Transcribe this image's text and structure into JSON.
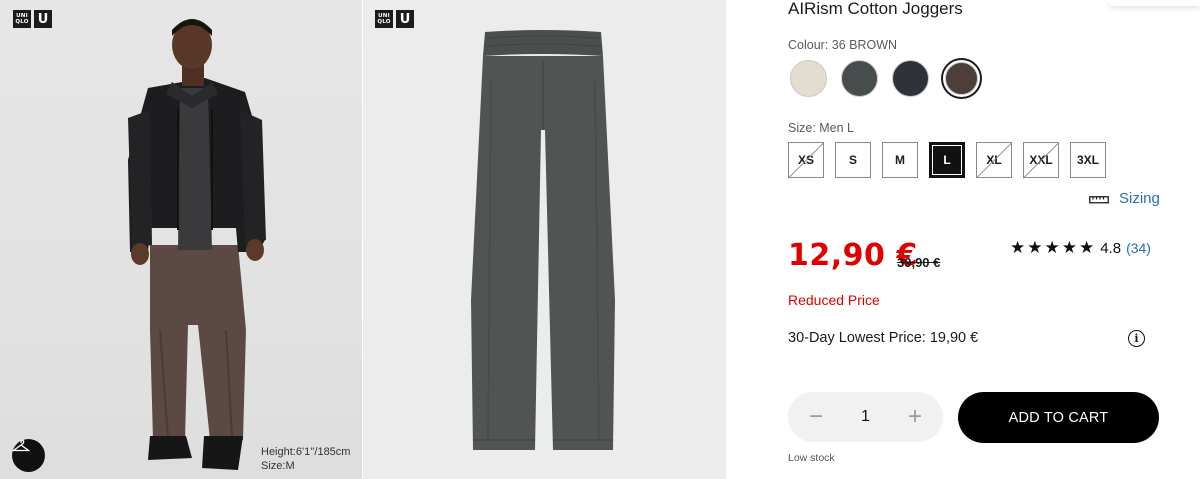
{
  "gallery": {
    "logo_top": "UNI",
    "logo_bottom": "QLO",
    "logo_u": "U",
    "model_height": "Height:6'1''/185cm",
    "model_size": "Size:M"
  },
  "product": {
    "title": "AIRism Cotton Joggers",
    "colour_label": "Colour: 36 BROWN",
    "colours": [
      {
        "name": "beige",
        "hex": "#e3ddd0",
        "selected": false
      },
      {
        "name": "dark-grey",
        "hex": "#474d4c",
        "selected": false
      },
      {
        "name": "navy",
        "hex": "#2f3239",
        "selected": false
      },
      {
        "name": "brown",
        "hex": "#4e3e3a",
        "selected": true
      }
    ],
    "size_label": "Size: Men L",
    "sizes": [
      {
        "label": "XS",
        "available": false,
        "selected": false
      },
      {
        "label": "S",
        "available": true,
        "selected": false
      },
      {
        "label": "M",
        "available": true,
        "selected": false
      },
      {
        "label": "L",
        "available": true,
        "selected": true
      },
      {
        "label": "XL",
        "available": false,
        "selected": false
      },
      {
        "label": "XXL",
        "available": false,
        "selected": false
      },
      {
        "label": "3XL",
        "available": true,
        "selected": false
      }
    ],
    "sizing_link": "Sizing",
    "price": "12,90 €",
    "old_price": "39,90 €",
    "rating_stars": "★★★★★",
    "rating_value": "4.8",
    "rating_count": "(34)",
    "reduced_label": "Reduced Price",
    "lowest_price": "30-Day Lowest Price: 19,90 €",
    "info_icon": "i",
    "quantity": "1",
    "qty_minus": "−",
    "qty_plus": "+",
    "add_to_cart": "ADD TO CART",
    "stock_status": "Low stock"
  },
  "colors": {
    "price_red": "#e00000",
    "link_blue": "#2a6db5",
    "button_black": "#000000"
  }
}
